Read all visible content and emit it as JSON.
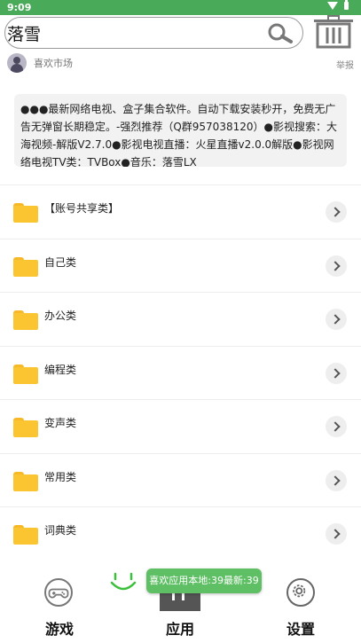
{
  "status_bar": {
    "time": "9:09"
  },
  "search": {
    "value": "落雪"
  },
  "market": {
    "label": "喜欢市场",
    "report": "举报"
  },
  "notice": {
    "text": "●●●最新网络电视、盒子集合软件。自动下载安装秒开，免费无广告无弹窗长期稳定。-强烈推荐（Q群957038120）●影视搜索：大海视频-解版V2.7.0●影视电视直播：火星直播v2.0.0解版●影视网络电视TV类：TVBox●音乐：落雪LX"
  },
  "categories": [
    {
      "label": "【账号共享类】"
    },
    {
      "label": "自己类"
    },
    {
      "label": "办公类"
    },
    {
      "label": "编程类"
    },
    {
      "label": "变声类"
    },
    {
      "label": "常用类"
    },
    {
      "label": "词典类"
    }
  ],
  "toast": {
    "text": "喜欢应用本地:39最新:39"
  },
  "nav": {
    "games": "游戏",
    "apps": "应用",
    "settings": "设置"
  },
  "colors": {
    "status_bar": "#49ab59",
    "folder": "#fbc531",
    "toast": "#5fbf64",
    "smile": "#3cc03c"
  }
}
